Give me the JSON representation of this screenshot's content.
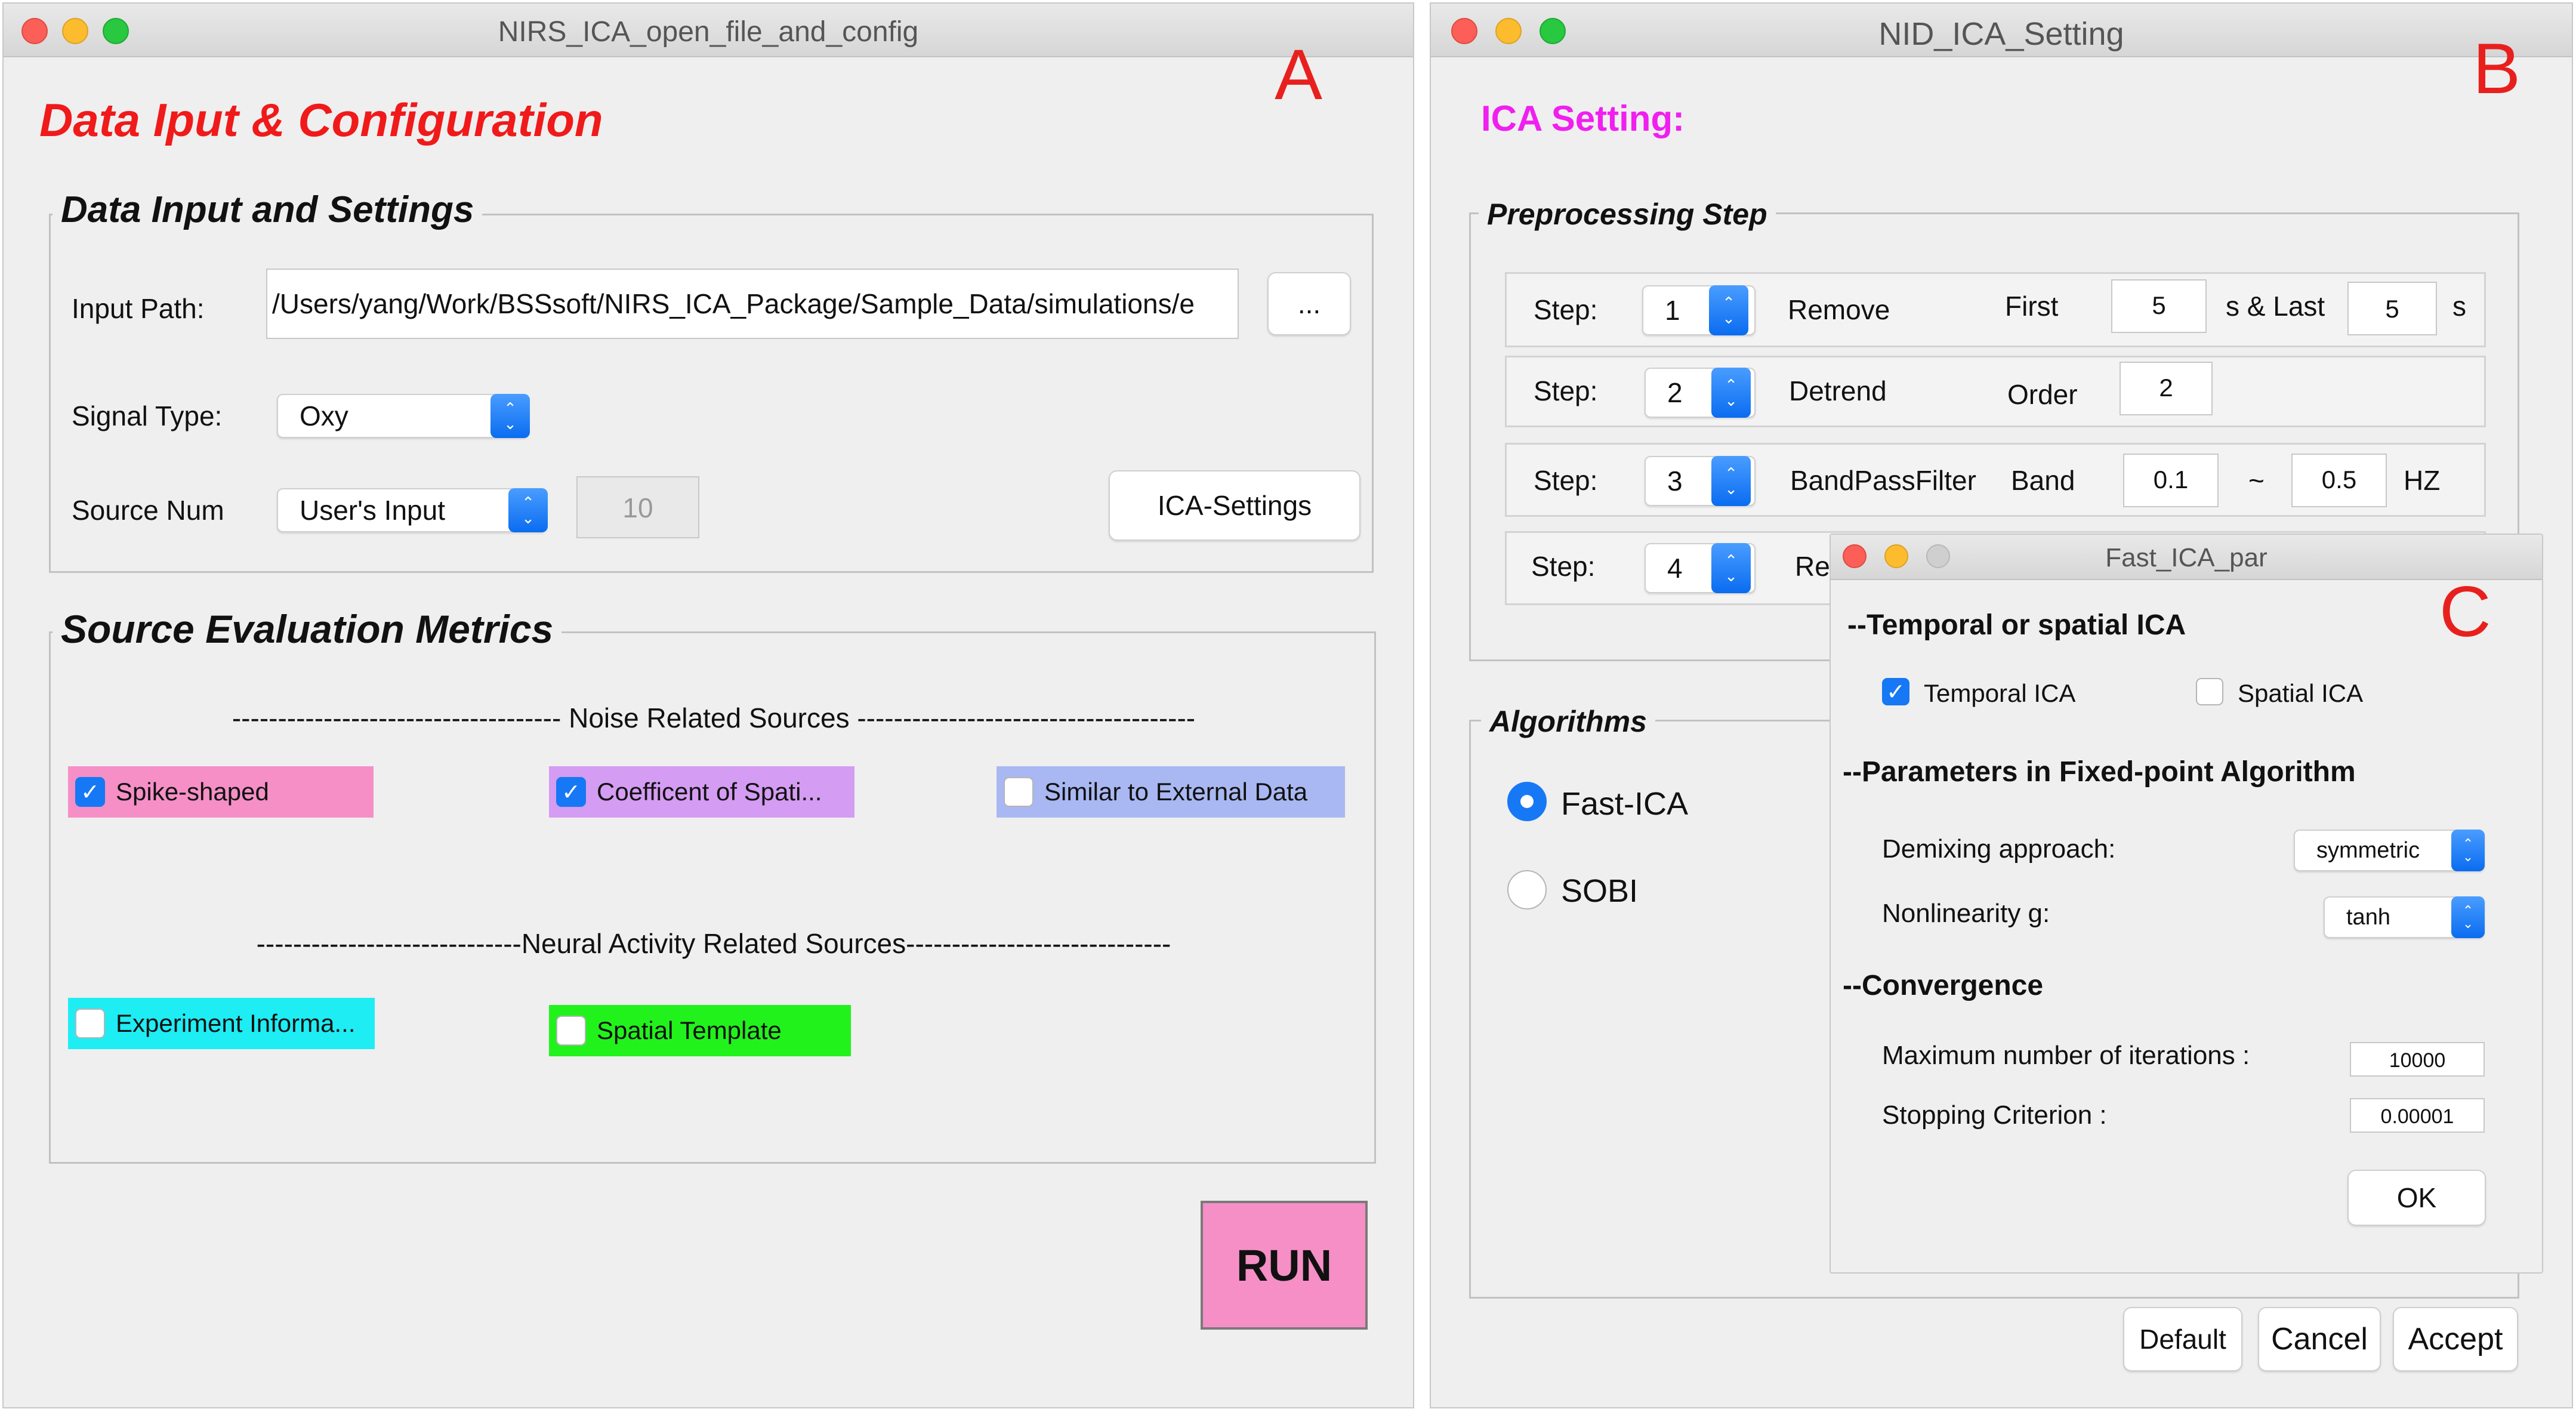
{
  "panelA": {
    "window_title": "NIRS_ICA_open_file_and_config",
    "letter": "A",
    "heading": "Data Iput & Configuration",
    "data_group_title": "Data Input and Settings",
    "input_path_label": "Input Path:",
    "input_path_value": "/Users/yang/Work/BSSsoft/NIRS_ICA_Package/Sample_Data/simulations/e",
    "browse_label": "...",
    "signal_type_label": "Signal Type:",
    "signal_type_value": "Oxy",
    "source_num_label": "Source Num",
    "source_num_value": "User's Input",
    "source_num_count": "10",
    "ica_settings_label": "ICA-Settings",
    "metrics_group_title": "Source Evaluation Metrics",
    "noise_separator": "------------------------------------ Noise Related Sources -------------------------------------",
    "noise_checkboxes": [
      {
        "label": "Spike-shaped",
        "checked": true,
        "color": "#f58fc6"
      },
      {
        "label": "Coefficent of Spati...",
        "checked": true,
        "color": "#d49cf2"
      },
      {
        "label": "Similar to External Data",
        "checked": false,
        "color": "#a9b8f2"
      }
    ],
    "neural_separator": "-----------------------------Neural Activity Related Sources-----------------------------",
    "neural_checkboxes": [
      {
        "label": "Experiment Informa...",
        "checked": false,
        "color": "#1eedf4"
      },
      {
        "label": "Spatial Template",
        "checked": false,
        "color": "#22f21c"
      }
    ],
    "run_label": "RUN",
    "run_color": "#f58fc6",
    "heading_color": "#f01a1a"
  },
  "panelB": {
    "window_title": "NID_ICA_Setting",
    "letter": "B",
    "heading": "ICA Setting:",
    "heading_color": "#f01ff0",
    "preproc_title": "Preprocessing Step",
    "steps": [
      {
        "step_label": "Step:",
        "step": "1",
        "name": "Remove",
        "param_label": "First",
        "v1": "5",
        "mid": "s & Last",
        "v2": "5",
        "unit": "s"
      },
      {
        "step_label": "Step:",
        "step": "2",
        "name": "Detrend",
        "param_label": "Order",
        "v1": "2"
      },
      {
        "step_label": "Step:",
        "step": "3",
        "name": "BandPassFilter",
        "param_label": "Band",
        "v1": "0.1",
        "mid": "~",
        "v2": "0.5",
        "unit": "HZ"
      },
      {
        "step_label": "Step:",
        "step": "4",
        "name": "Re"
      }
    ],
    "algorithms_title": "Algorithms",
    "algorithms": [
      {
        "label": "Fast-ICA",
        "selected": true
      },
      {
        "label": "SOBI",
        "selected": false
      }
    ],
    "buttons": {
      "default": "Default",
      "cancel": "Cancel",
      "accept": "Accept"
    }
  },
  "panelC": {
    "window_title": "Fast_ICA_par",
    "letter": "C",
    "section_type": "--Temporal or spatial ICA",
    "temporal_label": "Temporal ICA",
    "temporal_checked": true,
    "spatial_label": "Spatial ICA",
    "spatial_checked": false,
    "section_params": "--Parameters in Fixed-point Algorithm",
    "demixing_label": "Demixing approach:",
    "demixing_value": "symmetric",
    "nonlin_label": "Nonlinearity g:",
    "nonlin_value": "tanh",
    "section_conv": "--Convergence",
    "maxiter_label": "Maximum number of iterations :",
    "maxiter_value": "10000",
    "stop_label": "Stopping Criterion :",
    "stop_value": "0.00001",
    "ok_label": "OK"
  },
  "colors": {
    "accent_blue": "#1678f5",
    "letter_red": "#e8201d"
  }
}
